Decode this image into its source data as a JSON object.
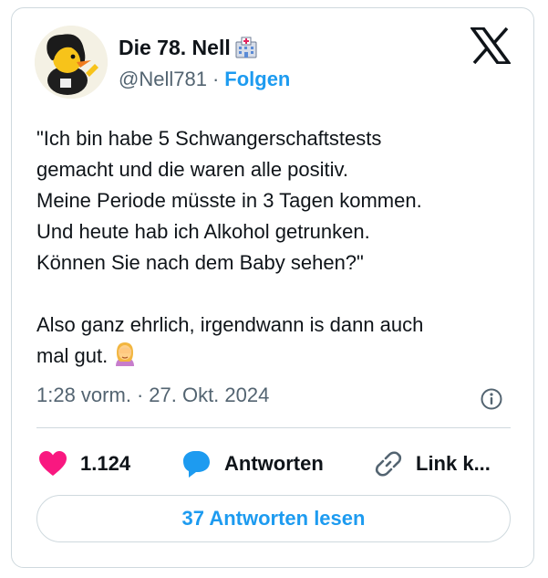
{
  "author": {
    "display_name": "Die 78. Nell",
    "handle": "@Nell781",
    "separator": "·",
    "follow_label": "Folgen"
  },
  "tweet": {
    "lines_1": [
      "\"Ich bin habe 5 Schwangerschaftstests",
      "gemacht und die waren alle positiv.",
      "Meine Periode müsste in 3 Tagen kommen.",
      "Und heute hab ich Alkohol getrunken.",
      "Können Sie nach dem Baby sehen?\""
    ],
    "lines_2": [
      "Also ganz ehrlich, irgendwann is dann auch",
      "mal gut."
    ]
  },
  "meta": {
    "time": "1:28 vorm.",
    "separator": "·",
    "date": "27. Okt. 2024"
  },
  "actions": {
    "likes": "1.124",
    "reply_label": "Antworten",
    "link_label": "Link k..."
  },
  "read_replies_label": "37 Antworten lesen",
  "colors": {
    "accent": "#1d9bf0",
    "like": "#f91880",
    "text": "#0f1419",
    "muted": "#536471",
    "border": "#cfd9de"
  },
  "icons": [
    "avatar-duck",
    "hospital-icon",
    "x-logo-icon",
    "facepalm-emoji-icon",
    "info-icon",
    "heart-icon",
    "reply-bubble-icon",
    "link-icon"
  ]
}
